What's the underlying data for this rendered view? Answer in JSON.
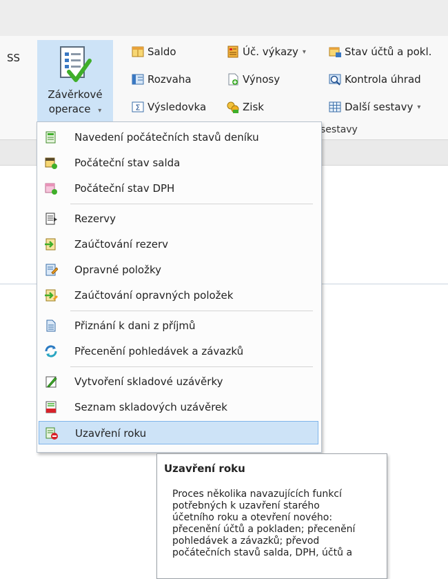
{
  "ribbon": {
    "ss_label": "SS",
    "big_button": {
      "line1": "Závěrkové",
      "line2": "operace",
      "caret": "▾"
    },
    "items_col1": [
      "Saldo",
      "Rozvaha",
      "Výsledovka"
    ],
    "items_col2": [
      "Úč. výkazy",
      "Výnosy",
      "Zisk"
    ],
    "items_col3": [
      "Stav účtů a pokl.",
      "Kontrola úhrad",
      "Další sestavy"
    ],
    "group_label": "sestavy",
    "caret": "▾"
  },
  "menu": {
    "items": [
      {
        "label": "Navedení počátečních stavů deníku",
        "icon": "initial-journal-icon"
      },
      {
        "label": "Počáteční stav salda",
        "icon": "initial-balance-icon"
      },
      {
        "label": "Počáteční stav DPH",
        "icon": "initial-vat-icon"
      },
      {
        "label": "Rezervy",
        "icon": "reserves-icon"
      },
      {
        "label": "Zaúčtování rezerv",
        "icon": "post-reserves-icon"
      },
      {
        "label": "Opravné položky",
        "icon": "adjustments-icon"
      },
      {
        "label": "Zaúčtování opravných položek",
        "icon": "post-adjustments-icon"
      },
      {
        "label": "Přiznání k dani z příjmů",
        "icon": "tax-return-icon"
      },
      {
        "label": "Přecenění pohledávek a závazků",
        "icon": "revaluation-icon"
      },
      {
        "label": "Vytvoření skladové uzávěrky",
        "icon": "create-stock-closing-icon"
      },
      {
        "label": "Seznam skladových uzávěrek",
        "icon": "stock-closing-list-icon"
      },
      {
        "label": "Uzavření roku",
        "icon": "year-close-icon"
      }
    ],
    "selected_index": 11
  },
  "tooltip": {
    "title": "Uzavření roku",
    "body": "Proces několika navazujících funkcí\npotřebných k uzavření starého\núčetního roku a otevření nového:\npřecenění účtů a pokladen; přecenění\npohledávek a závazků; převod\npočátečních stavů salda, DPH, účtů a"
  },
  "colors": {
    "selection_bg": "#cde3f7",
    "selection_border": "#7eb4ea",
    "accent_green": "#3fae2a",
    "accent_red": "#d8222a"
  }
}
